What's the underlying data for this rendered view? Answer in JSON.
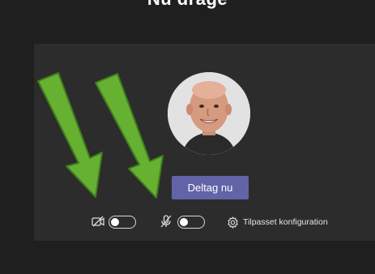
{
  "header": {
    "title": "Nu drage"
  },
  "prejoin": {
    "join_button_label": "Deltag nu",
    "camera_toggle_on": false,
    "mic_toggle_on": false,
    "settings_label": "Tilpasset konfiguration"
  },
  "colors": {
    "background": "#1f1f1f",
    "panel": "#2c2c2c",
    "join_button": "#6264a7",
    "arrow_fill": "#66b032",
    "arrow_outline": "#3f7d1c"
  },
  "icons": [
    "camera-off-icon",
    "mic-off-icon",
    "gear-icon"
  ]
}
